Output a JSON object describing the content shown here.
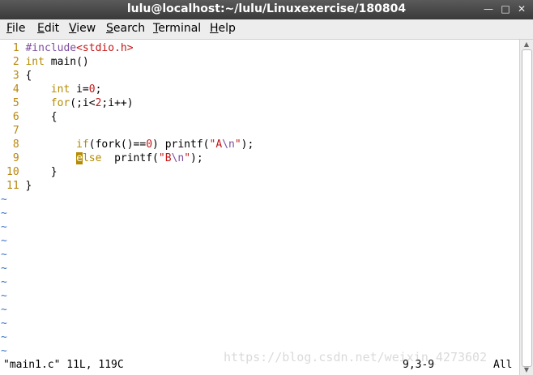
{
  "window": {
    "title": "lulu@localhost:~/lulu/Linuxexercise/180804"
  },
  "menu": [
    {
      "first": "F",
      "rest": "ile"
    },
    {
      "first": "E",
      "rest": "dit"
    },
    {
      "first": "V",
      "rest": "iew"
    },
    {
      "first": "S",
      "rest": "earch"
    },
    {
      "first": "T",
      "rest": "erminal"
    },
    {
      "first": "H",
      "rest": "elp"
    }
  ],
  "editor": {
    "lines": [
      {
        "num": " 1 ",
        "parts": [
          {
            "t": "#include",
            "c": "pp"
          },
          {
            "t": "<stdio.h>",
            "c": "str"
          }
        ]
      },
      {
        "num": " 2 ",
        "parts": [
          {
            "t": "int",
            "c": "kw"
          },
          {
            "t": " main()",
            "c": ""
          }
        ]
      },
      {
        "num": " 3 ",
        "parts": [
          {
            "t": "{",
            "c": ""
          }
        ]
      },
      {
        "num": " 4 ",
        "parts": [
          {
            "t": "    ",
            "c": ""
          },
          {
            "t": "int",
            "c": "kw"
          },
          {
            "t": " i=",
            "c": ""
          },
          {
            "t": "0",
            "c": "str"
          },
          {
            "t": ";",
            "c": ""
          }
        ]
      },
      {
        "num": " 5 ",
        "parts": [
          {
            "t": "    ",
            "c": ""
          },
          {
            "t": "for",
            "c": "kw"
          },
          {
            "t": "(;i<",
            "c": ""
          },
          {
            "t": "2",
            "c": "str"
          },
          {
            "t": ";i++)",
            "c": ""
          }
        ]
      },
      {
        "num": " 6 ",
        "parts": [
          {
            "t": "    {",
            "c": ""
          }
        ]
      },
      {
        "num": " 7 ",
        "parts": [
          {
            "t": "",
            "c": ""
          }
        ]
      },
      {
        "num": " 8 ",
        "parts": [
          {
            "t": "        ",
            "c": ""
          },
          {
            "t": "if",
            "c": "kw"
          },
          {
            "t": "(fork()==",
            "c": ""
          },
          {
            "t": "0",
            "c": "str"
          },
          {
            "t": ") printf(",
            "c": ""
          },
          {
            "t": "\"A",
            "c": "str"
          },
          {
            "t": "\\n",
            "c": "pp"
          },
          {
            "t": "\"",
            "c": "str"
          },
          {
            "t": ");",
            "c": ""
          }
        ]
      },
      {
        "num": " 9 ",
        "parts": [
          {
            "t": "        ",
            "c": ""
          },
          {
            "t": "e",
            "c": "cursor"
          },
          {
            "t": "lse",
            "c": "kw"
          },
          {
            "t": "  printf(",
            "c": ""
          },
          {
            "t": "\"B",
            "c": "str"
          },
          {
            "t": "\\n",
            "c": "pp"
          },
          {
            "t": "\"",
            "c": "str"
          },
          {
            "t": ");",
            "c": ""
          }
        ]
      },
      {
        "num": "10 ",
        "parts": [
          {
            "t": "    }",
            "c": ""
          }
        ]
      },
      {
        "num": "11 ",
        "parts": [
          {
            "t": "}",
            "c": ""
          }
        ]
      }
    ],
    "tilde": "~",
    "tilde_count": 12
  },
  "status": {
    "file": "\"main1.c\" 11L, 119C",
    "position": "9,3-9",
    "scroll": "All"
  },
  "watermark": "https://blog.csdn.net/weixin_4273602",
  "colors": {
    "linenum": "#b8860b",
    "tilde": "#3f74c6",
    "string": "#c21818",
    "keyword": "#b58b00",
    "preproc": "#7d4d9e"
  }
}
